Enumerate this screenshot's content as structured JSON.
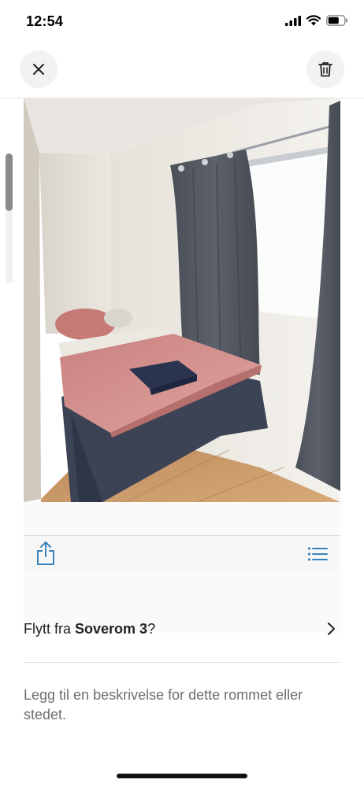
{
  "status_bar": {
    "time": "12:54",
    "icons": [
      "signal-icon",
      "wifi-icon",
      "battery-icon"
    ]
  },
  "header": {
    "close_icon": "close-icon",
    "delete_icon": "trash-icon"
  },
  "photo": {
    "description_of_icons": [
      "share-icon",
      "list-icon"
    ]
  },
  "move_row": {
    "prefix": "Flytt fra ",
    "room": "Soverom 3",
    "suffix": "?",
    "chevron_icon": "chevron-right-icon"
  },
  "description": {
    "placeholder": "Legg til en beskrivelse for dette rommet eller stedet."
  },
  "colors": {
    "accent": "#3b82b9",
    "text": "#222222",
    "muted": "#6e6e6e"
  }
}
